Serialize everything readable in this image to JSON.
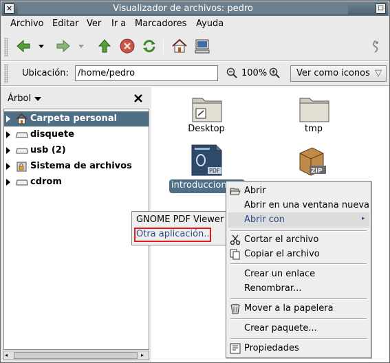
{
  "window": {
    "title": "Visualizador de archivos: pedro",
    "controls": [
      "close-icon",
      "maximize-icon"
    ]
  },
  "menubar": {
    "items": [
      {
        "label": "Archivo"
      },
      {
        "label": "Editar"
      },
      {
        "label": "Ver"
      },
      {
        "label": "Ir a"
      },
      {
        "label": "Marcadores"
      },
      {
        "label": "Ayuda"
      }
    ]
  },
  "toolbar": {
    "buttons": [
      "back-icon",
      "back-dropdown-icon",
      "forward-icon",
      "forward-dropdown-icon",
      "up-icon",
      "stop-icon",
      "reload-icon",
      "home-icon",
      "computer-icon",
      "throbber-icon"
    ]
  },
  "location": {
    "label": "Ubicación:",
    "value": "/home/pedro",
    "zoom": "100%",
    "view_as": "Ver como iconos"
  },
  "sidebar": {
    "title": "Árbol",
    "items": [
      {
        "label": "Carpeta personal",
        "icon": "home-icon",
        "selected": true
      },
      {
        "label": "disquete",
        "icon": "drive-icon",
        "selected": false
      },
      {
        "label": "usb (2)",
        "icon": "drive-icon",
        "selected": false
      },
      {
        "label": "Sistema de archivos",
        "icon": "filesystem-icon",
        "selected": false
      },
      {
        "label": "cdrom",
        "icon": "drive-icon",
        "selected": false
      }
    ]
  },
  "files": [
    {
      "label": "Desktop",
      "icon": "folder-icon"
    },
    {
      "label": "tmp",
      "icon": "folder-icon"
    },
    {
      "label": "introduccion",
      "icon": "pdf-file-icon",
      "selected": true
    },
    {
      "label": "",
      "icon": "zip-file-icon"
    }
  ],
  "context_menu": {
    "items": [
      {
        "label": "Abrir",
        "icon": "open-folder-icon"
      },
      {
        "label": "Abrir en una ventana nueva"
      },
      {
        "label": "Abrir con",
        "highlighted": true,
        "submenu": true
      },
      {
        "label": "Cortar el archivo",
        "icon": "cut-icon"
      },
      {
        "label": "Copiar el archivo",
        "icon": "copy-icon"
      },
      {
        "label": "Crear un enlace"
      },
      {
        "label": "Renombrar..."
      },
      {
        "label": "Mover a la papelera",
        "icon": "trash-icon"
      },
      {
        "label": "Crear paquete..."
      },
      {
        "label": "Propiedades",
        "icon": "properties-icon"
      }
    ]
  },
  "submenu": {
    "items": [
      {
        "label": "GNOME PDF Viewer"
      },
      {
        "label": "Otra aplicación...",
        "highlighted_box": true
      }
    ]
  },
  "colors": {
    "titlebar": "#5f7280",
    "selection": "#4f6f85",
    "annotation": "#e01c1c",
    "link_blue": "#2c4a86"
  }
}
